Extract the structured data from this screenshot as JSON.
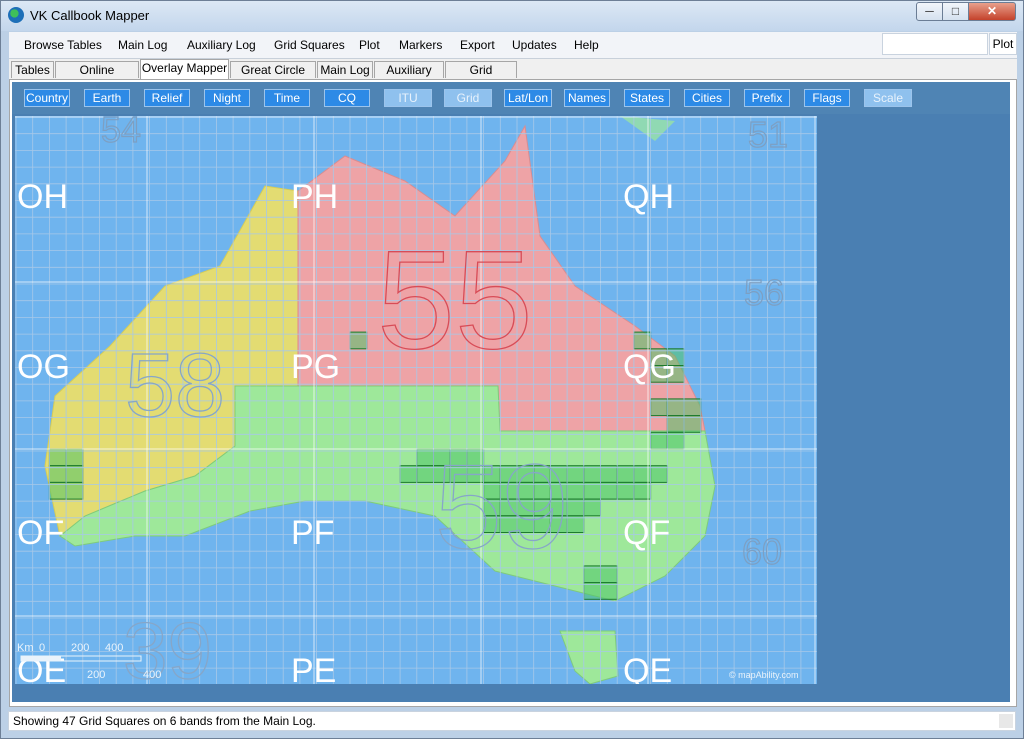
{
  "window": {
    "title": "VK Callbook Mapper"
  },
  "menu": {
    "items": [
      "Browse Tables",
      "Main Log",
      "Auxiliary Log",
      "Grid Squares",
      "Plot",
      "Markers",
      "Export",
      "Updates",
      "Help"
    ],
    "search_value": "",
    "plot_label": "Plot"
  },
  "tabs": [
    "Tables",
    "Online Mapping",
    "Overlay Mapper",
    "Great Circle Map",
    "Main Log",
    "Auxiliary Log",
    "Grid Squares"
  ],
  "active_tab": "Overlay Mapper",
  "overlays": {
    "buttons": [
      "Country",
      "Earth",
      "Relief",
      "Night",
      "Time",
      "CQ",
      "ITU",
      "Grid",
      "Lat/Lon",
      "Names",
      "States",
      "Cities",
      "Prefix",
      "Flags",
      "Scale"
    ],
    "on": [
      "ITU",
      "Grid",
      "Scale"
    ]
  },
  "map": {
    "field_labels": [
      "OH",
      "PH",
      "QH",
      "OG",
      "PG",
      "QG",
      "OF",
      "PF",
      "QF",
      "OE",
      "PE",
      "QE"
    ],
    "cq_zone_numbers": [
      "54",
      "51",
      "56",
      "60"
    ],
    "itu_zone_numbers": [
      "55",
      "58",
      "59",
      "39"
    ],
    "scale": {
      "unit_label": "Km",
      "top_ticks": [
        "0",
        "200",
        "400"
      ],
      "bottom_ticks": [
        "200",
        "400"
      ]
    },
    "attribution": "© mapAbility.com",
    "colors": {
      "ocean": "#6fb4ee",
      "land_west": "#e3dc72",
      "land_north": "#eea3a6",
      "land_south": "#9ee89a",
      "highlight_squares": "#4fc46a",
      "grid_lines": "#a7c8e8"
    }
  },
  "status": {
    "text": "Showing 47 Grid Squares on 6 bands from the Main Log."
  }
}
